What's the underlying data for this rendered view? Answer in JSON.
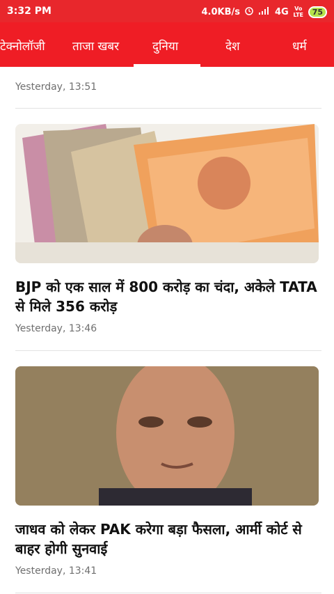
{
  "status_bar": {
    "time": "3:32 PM",
    "network_speed": "4.0KB/s",
    "network_type": "4G",
    "volte": "Vo LTE",
    "battery": "75"
  },
  "tabs": [
    {
      "label": "टेक्नोलॉजी"
    },
    {
      "label": "ताजा खबर"
    },
    {
      "label": "दुनिया"
    },
    {
      "label": "देश"
    },
    {
      "label": "धर्म"
    }
  ],
  "active_tab": "दुनिया",
  "articles": [
    {
      "headline": "",
      "timestamp": "Yesterday, 13:51"
    },
    {
      "headline": "BJP को एक साल में 800 करोड़ का चंदा, अकेले TATA से मिले 356 करोड़",
      "timestamp": "Yesterday, 13:46"
    },
    {
      "headline": "जाधव को लेकर PAK करेगा बड़ा फैसला, आर्मी कोर्ट से बाहर होगी सुनवाई",
      "timestamp": "Yesterday, 13:41"
    }
  ],
  "colors": {
    "accent": "#ef1d25",
    "statusbar": "#e8272c"
  }
}
